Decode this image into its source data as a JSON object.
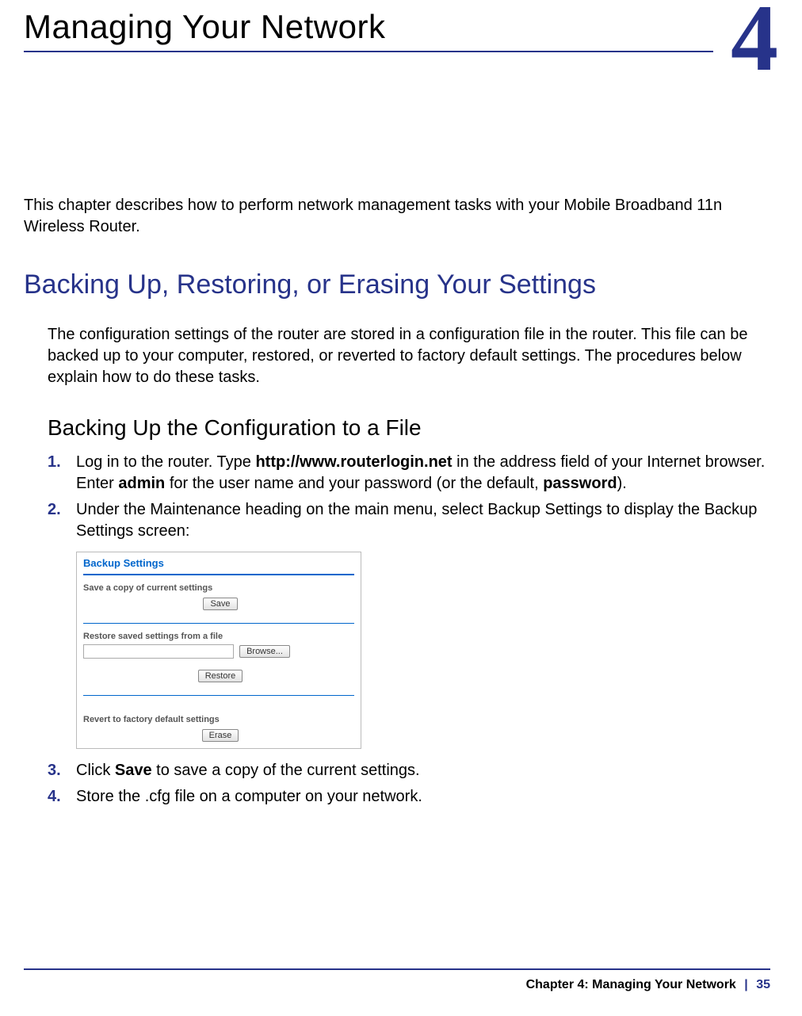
{
  "chapter": {
    "number": "4",
    "title": "Managing Your Network"
  },
  "intro": "This chapter describes how to perform network management tasks with your Mobile Broadband 11n Wireless Router.",
  "section1": {
    "title": "Backing Up, Restoring, or Erasing Your Settings",
    "text": "The configuration settings of the router are stored in a configuration file in the router. This file can be backed up to your computer, restored, or reverted to factory default settings. The procedures below explain how to do these tasks."
  },
  "subsection1": {
    "title": "Backing Up the Configuration to a File",
    "steps": [
      {
        "num": "1.",
        "pre": "Log in to the router. Type ",
        "bold1": "http://www.routerlogin.net",
        "mid1": " in the address field of your Internet browser. Enter ",
        "bold2": "admin",
        "mid2": " for the user name and your password (or the default, ",
        "bold3": "password",
        "post": ")."
      },
      {
        "num": "2.",
        "text": "Under the Maintenance heading on the main menu, select Backup Settings to display the Backup Settings screen:"
      },
      {
        "num": "3.",
        "pre": "Click ",
        "bold1": "Save",
        "post": " to save a copy of the current settings."
      },
      {
        "num": "4.",
        "text": "Store the .cfg file on a computer on your network."
      }
    ]
  },
  "screenshot": {
    "title": "Backup Settings",
    "sec1": "Save a copy of current settings",
    "btn_save": "Save",
    "sec2": "Restore saved settings from a file",
    "btn_browse": "Browse...",
    "btn_restore": "Restore",
    "sec3": "Revert to factory default settings",
    "btn_erase": "Erase"
  },
  "footer": {
    "chapter_label": "Chapter 4:  Managing Your Network",
    "sep": "|",
    "page": "35"
  }
}
